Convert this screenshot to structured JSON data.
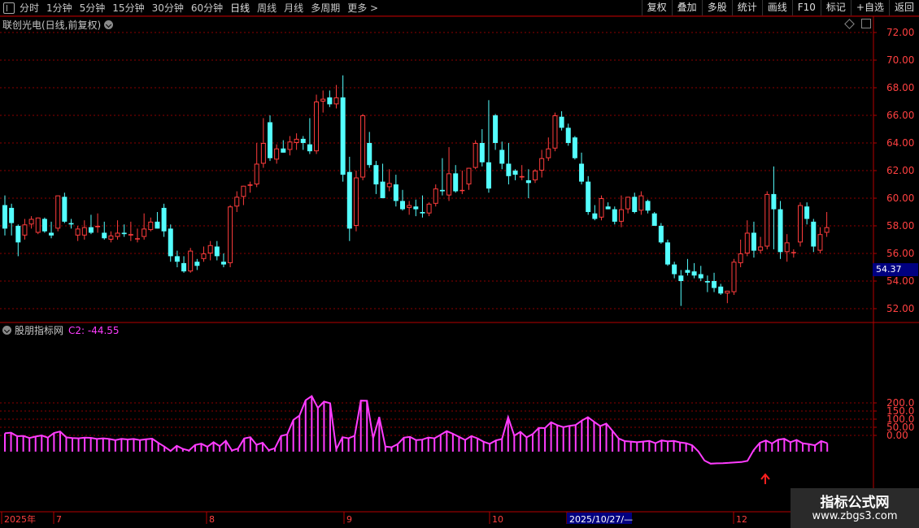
{
  "toolbar": {
    "periods": [
      "分时",
      "1分钟",
      "5分钟",
      "15分钟",
      "30分钟",
      "60分钟",
      "日线",
      "周线",
      "月线",
      "多周期",
      "更多 >"
    ],
    "active_period": "日线",
    "actions": [
      "复权",
      "叠加",
      "多股",
      "统计",
      "画线",
      "F10",
      "标记",
      "+自选",
      "返回"
    ]
  },
  "stock": {
    "title": "联创光电(日线,前复权)"
  },
  "indicator": {
    "name": "股朋指标网",
    "value_label": "C2: -44.55"
  },
  "price_tag": "54.37",
  "watermark": {
    "title": "指标公式网",
    "url": "www.zbgs3.com"
  },
  "colors": {
    "up": "#ff3c3c",
    "down": "#54ffff",
    "indicator": "#ff3cff",
    "grid": "#8b0000",
    "axis": "#b40000"
  },
  "chart_data": [
    {
      "type": "candlestick",
      "y_ticks": [
        "72.00",
        "70.00",
        "68.00",
        "66.00",
        "64.00",
        "62.00",
        "60.00",
        "58.00",
        "56.00",
        "54.00",
        "52.00"
      ],
      "ylim": [
        51.2,
        72.4
      ],
      "candles": [
        [
          59.5,
          60.2,
          57.3,
          57.8
        ],
        [
          59.3,
          59.6,
          57.3,
          58.2
        ],
        [
          58.0,
          58.1,
          55.8,
          56.8
        ],
        [
          57.3,
          58.5,
          57.0,
          58.1
        ],
        [
          58.1,
          58.7,
          57.8,
          58.5
        ],
        [
          57.5,
          58.6,
          57.4,
          58.6
        ],
        [
          58.5,
          58.6,
          57.5,
          57.6
        ],
        [
          57.5,
          58.3,
          57.1,
          57.3
        ],
        [
          57.8,
          60.2,
          57.6,
          60.2
        ],
        [
          60.1,
          60.4,
          58.2,
          58.3
        ],
        [
          58.2,
          58.5,
          57.8,
          58.1
        ],
        [
          57.3,
          58.0,
          56.9,
          57.8
        ],
        [
          57.3,
          58.4,
          57.0,
          57.9
        ],
        [
          57.9,
          58.8,
          57.4,
          57.5
        ],
        [
          57.9,
          58.9,
          57.5,
          58.0
        ],
        [
          57.5,
          58.3,
          57.0,
          57.1
        ],
        [
          57.0,
          57.6,
          56.8,
          57.3
        ],
        [
          57.2,
          58.4,
          57.0,
          57.5
        ],
        [
          57.5,
          58.1,
          57.2,
          57.4
        ],
        [
          57.3,
          58.3,
          56.9,
          57.4
        ],
        [
          57.1,
          57.8,
          56.8,
          57.1
        ],
        [
          57.2,
          58.9,
          57.0,
          57.8
        ],
        [
          57.7,
          58.6,
          57.6,
          58.3
        ],
        [
          58.3,
          59.0,
          57.8,
          57.8
        ],
        [
          59.3,
          59.6,
          57.2,
          57.6
        ],
        [
          57.8,
          58.1,
          55.4,
          55.8
        ],
        [
          55.8,
          56.2,
          55.0,
          55.4
        ],
        [
          55.3,
          55.8,
          54.6,
          54.7
        ],
        [
          54.7,
          56.4,
          54.6,
          56.2
        ],
        [
          55.4,
          55.6,
          54.8,
          55.1
        ],
        [
          55.6,
          56.5,
          55.4,
          56.0
        ],
        [
          56.0,
          56.9,
          55.5,
          56.6
        ],
        [
          56.5,
          56.9,
          55.5,
          55.8
        ],
        [
          55.4,
          56.0,
          55.0,
          55.2
        ],
        [
          55.3,
          59.5,
          55.0,
          59.4
        ],
        [
          59.4,
          60.5,
          59.0,
          60.1
        ],
        [
          60.1,
          60.9,
          59.5,
          60.9
        ],
        [
          60.9,
          61.2,
          60.4,
          61.0
        ],
        [
          61.0,
          64.0,
          60.8,
          62.5
        ],
        [
          62.5,
          65.8,
          62.2,
          64.0
        ],
        [
          65.5,
          66.0,
          62.7,
          62.9
        ],
        [
          62.8,
          63.9,
          62.5,
          63.6
        ],
        [
          63.6,
          64.2,
          63.3,
          63.3
        ],
        [
          63.5,
          64.5,
          63.1,
          64.1
        ],
        [
          64.0,
          64.7,
          63.5,
          64.3
        ],
        [
          64.3,
          64.5,
          63.5,
          64.0
        ],
        [
          63.9,
          65.8,
          63.2,
          63.4
        ],
        [
          63.4,
          67.5,
          63.2,
          67.0
        ],
        [
          67.0,
          67.8,
          66.2,
          67.2
        ],
        [
          67.3,
          67.8,
          66.6,
          66.8
        ],
        [
          66.8,
          68.2,
          66.5,
          67.3
        ],
        [
          67.3,
          68.9,
          61.2,
          61.7
        ],
        [
          61.9,
          63.0,
          56.9,
          57.8
        ],
        [
          58.0,
          62.0,
          57.6,
          61.5
        ],
        [
          61.5,
          66.1,
          61.3,
          66.0
        ],
        [
          64.0,
          64.8,
          62.2,
          62.4
        ],
        [
          62.4,
          62.7,
          60.3,
          61.0
        ],
        [
          61.2,
          62.5,
          60.0,
          60.0
        ],
        [
          60.8,
          62.1,
          60.5,
          61.1
        ],
        [
          61.0,
          61.7,
          59.4,
          59.8
        ],
        [
          59.8,
          60.6,
          59.1,
          59.2
        ],
        [
          59.3,
          59.8,
          58.8,
          59.5
        ],
        [
          59.4,
          59.9,
          58.7,
          59.2
        ],
        [
          59.0,
          60.2,
          58.6,
          58.9
        ],
        [
          58.9,
          59.7,
          58.7,
          59.6
        ],
        [
          59.6,
          61.0,
          59.4,
          60.7
        ],
        [
          60.6,
          62.9,
          60.2,
          60.5
        ],
        [
          60.2,
          63.7,
          59.8,
          61.8
        ],
        [
          61.8,
          62.4,
          60.4,
          60.5
        ],
        [
          60.6,
          62.0,
          60.3,
          60.6
        ],
        [
          61.0,
          62.2,
          60.6,
          62.2
        ],
        [
          62.2,
          64.2,
          62.1,
          64.0
        ],
        [
          64.0,
          65.0,
          62.3,
          62.6
        ],
        [
          62.6,
          67.1,
          60.4,
          60.7
        ],
        [
          66.0,
          66.1,
          63.5,
          64.0
        ],
        [
          63.5,
          64.1,
          62.1,
          62.5
        ],
        [
          62.5,
          64.0,
          61.0,
          61.6
        ],
        [
          62.0,
          62.1,
          61.3,
          61.7
        ],
        [
          61.5,
          62.4,
          61.3,
          61.6
        ],
        [
          61.3,
          62.1,
          60.0,
          61.1
        ],
        [
          61.3,
          62.1,
          61.1,
          62.0
        ],
        [
          62.0,
          63.5,
          61.5,
          62.9
        ],
        [
          62.9,
          64.4,
          62.7,
          63.6
        ],
        [
          63.6,
          66.2,
          63.4,
          66.0
        ],
        [
          65.9,
          66.3,
          64.9,
          65.1
        ],
        [
          65.1,
          65.4,
          63.8,
          64.0
        ],
        [
          64.4,
          64.5,
          62.8,
          62.9
        ],
        [
          62.5,
          63.3,
          61.0,
          61.2
        ],
        [
          61.2,
          61.6,
          58.8,
          59.0
        ],
        [
          58.9,
          59.5,
          58.4,
          58.5
        ],
        [
          58.6,
          60.2,
          58.4,
          60.0
        ],
        [
          59.4,
          59.7,
          59.2,
          59.2
        ],
        [
          59.2,
          59.4,
          58.1,
          58.3
        ],
        [
          58.3,
          60.2,
          57.9,
          59.2
        ],
        [
          59.2,
          60.1,
          58.9,
          60.1
        ],
        [
          60.1,
          60.4,
          58.9,
          59.0
        ],
        [
          59.1,
          60.5,
          58.8,
          60.2
        ],
        [
          59.8,
          59.9,
          58.9,
          59.1
        ],
        [
          58.9,
          59.0,
          58.0,
          58.0
        ],
        [
          58.0,
          58.2,
          56.7,
          56.8
        ],
        [
          56.8,
          57.0,
          55.1,
          55.2
        ],
        [
          55.2,
          55.4,
          54.2,
          54.5
        ],
        [
          54.4,
          54.8,
          52.2,
          54.0
        ],
        [
          54.8,
          55.6,
          54.4,
          54.6
        ],
        [
          54.7,
          55.3,
          54.2,
          54.4
        ],
        [
          54.5,
          55.1,
          54.0,
          54.2
        ],
        [
          54.0,
          54.4,
          53.2,
          53.9
        ],
        [
          54.0,
          54.6,
          53.2,
          53.5
        ],
        [
          53.6,
          53.8,
          53.0,
          53.1
        ],
        [
          53.1,
          53.3,
          52.4,
          53.3
        ],
        [
          53.2,
          55.6,
          53.0,
          55.4
        ],
        [
          55.3,
          57.0,
          55.0,
          56.0
        ],
        [
          56.0,
          58.4,
          55.8,
          57.5
        ],
        [
          57.5,
          58.3,
          55.7,
          56.2
        ],
        [
          56.2,
          57.2,
          56.0,
          56.5
        ],
        [
          56.5,
          60.5,
          56.3,
          60.3
        ],
        [
          60.3,
          62.3,
          56.3,
          59.2
        ],
        [
          59.2,
          59.8,
          55.6,
          56.1
        ],
        [
          56.1,
          57.4,
          55.4,
          56.8
        ],
        [
          56.1,
          56.3,
          55.7,
          56.1
        ],
        [
          56.8,
          59.7,
          56.5,
          59.5
        ],
        [
          59.4,
          59.7,
          58.1,
          58.5
        ],
        [
          58.3,
          58.5,
          56.1,
          56.5
        ],
        [
          56.2,
          57.9,
          56.0,
          57.4
        ],
        [
          57.5,
          59.0,
          57.2,
          57.9
        ]
      ]
    },
    {
      "type": "bar",
      "series": [
        {
          "name": "C2",
          "values": [
            13,
            17,
            -5,
            -3,
            -16,
            -7,
            0,
            -14,
            15,
            24,
            -12,
            -16,
            -18,
            -14,
            -15,
            -22,
            -18,
            -22,
            -29,
            -21,
            -25,
            -22,
            -29,
            -24,
            -20,
            -46,
            -69,
            -96,
            -64,
            -83,
            -93,
            -59,
            -51,
            -70,
            -42,
            -66,
            -33,
            -93,
            -81,
            -19,
            -11,
            -58,
            -45,
            -91,
            -79,
            -3,
            6,
            95,
            122,
            216,
            242,
            169,
            208,
            198,
            -86,
            -11,
            -18,
            -2,
            214,
            213,
            -18,
            113,
            -69,
            -73,
            -54,
            -14,
            -9,
            -29,
            -26,
            -13,
            -18,
            4,
            26,
            10,
            -9,
            -28,
            -4,
            -18,
            -39,
            -52,
            -31,
            -22,
            112,
            -2,
            22,
            -12,
            8,
            46,
            45,
            81,
            63,
            51,
            59,
            64,
            91,
            112,
            84,
            57,
            73,
            28,
            -19,
            -35,
            -38,
            -42,
            -38,
            -34,
            -48,
            -31,
            -37,
            -34,
            -43,
            -48,
            -61,
            -99,
            -155,
            -174,
            -172,
            -171,
            -169,
            -166,
            -164,
            -157,
            -91,
            -46,
            -31,
            -50,
            -26,
            -21,
            -42,
            -28,
            -49,
            -54,
            -61,
            -35,
            -48
          ]
        }
      ],
      "y_ticks": [
        "200.0",
        "150.0",
        "100.0",
        "50.00",
        "0.00"
      ],
      "ylim": [
        -180,
        240
      ]
    }
  ],
  "x_axis": {
    "labels": [
      "2025年",
      "7",
      "8",
      "9",
      "10",
      "2025/10/27/—",
      "12"
    ],
    "highlighted": "2025/10/27/—"
  }
}
